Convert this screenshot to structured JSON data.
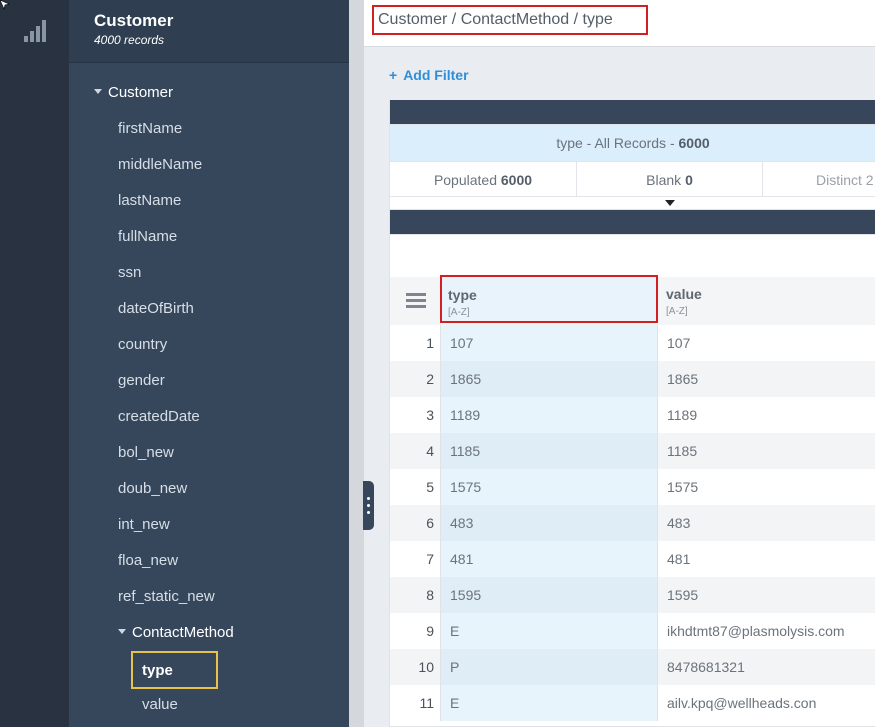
{
  "rail": {
    "items": [
      {
        "icon": "bar-chart-icon",
        "active": false
      },
      {
        "icon": "grid-icon",
        "active": true
      }
    ]
  },
  "sidebar": {
    "title": "Customer",
    "subtitle": "4000 records",
    "root": "Customer",
    "fields": [
      "firstName",
      "middleName",
      "lastName",
      "fullName",
      "ssn",
      "dateOfBirth",
      "country",
      "gender",
      "createdDate",
      "bol_new",
      "doub_new",
      "int_new",
      "floa_new",
      "ref_static_new"
    ],
    "child_group": "ContactMethod",
    "child_fields": [
      "type",
      "value"
    ],
    "selected": "type",
    "selected_color": "#e8c34a"
  },
  "breadcrumb": "Customer / ContactMethod / type",
  "filter": {
    "add_label": "Add Filter",
    "icon": "plus-icon",
    "color": "#2e8fd8"
  },
  "profile": {
    "field": "type",
    "scope": "All Records",
    "total": "6000",
    "populated_label": "Populated",
    "populated": "6000",
    "blank_label": "Blank",
    "blank": "0",
    "distinct_label": "Distinct",
    "distinct": "2"
  },
  "grid": {
    "columns": [
      {
        "name": "type",
        "sort": "[A-Z]"
      },
      {
        "name": "value",
        "sort": "[A-Z]"
      }
    ],
    "rows": [
      {
        "n": "1",
        "type": "107",
        "value": "107"
      },
      {
        "n": "2",
        "type": "1865",
        "value": "1865"
      },
      {
        "n": "3",
        "type": "1189",
        "value": "1189"
      },
      {
        "n": "4",
        "type": "1185",
        "value": "1185"
      },
      {
        "n": "5",
        "type": "1575",
        "value": "1575"
      },
      {
        "n": "6",
        "type": "483",
        "value": "483"
      },
      {
        "n": "7",
        "type": "481",
        "value": "481"
      },
      {
        "n": "8",
        "type": "1595",
        "value": "1595"
      },
      {
        "n": "9",
        "type": "E",
        "value": "ikhdtmt87@plasmolysis.com"
      },
      {
        "n": "10",
        "type": "P",
        "value": "8478681321"
      },
      {
        "n": "11",
        "type": "E",
        "value": "ailv.kpq@wellheads.con"
      }
    ]
  },
  "colors": {
    "highlight_border": "#d31f1f",
    "rail_bg": "#283240",
    "sidebar_bg": "#36475c"
  }
}
